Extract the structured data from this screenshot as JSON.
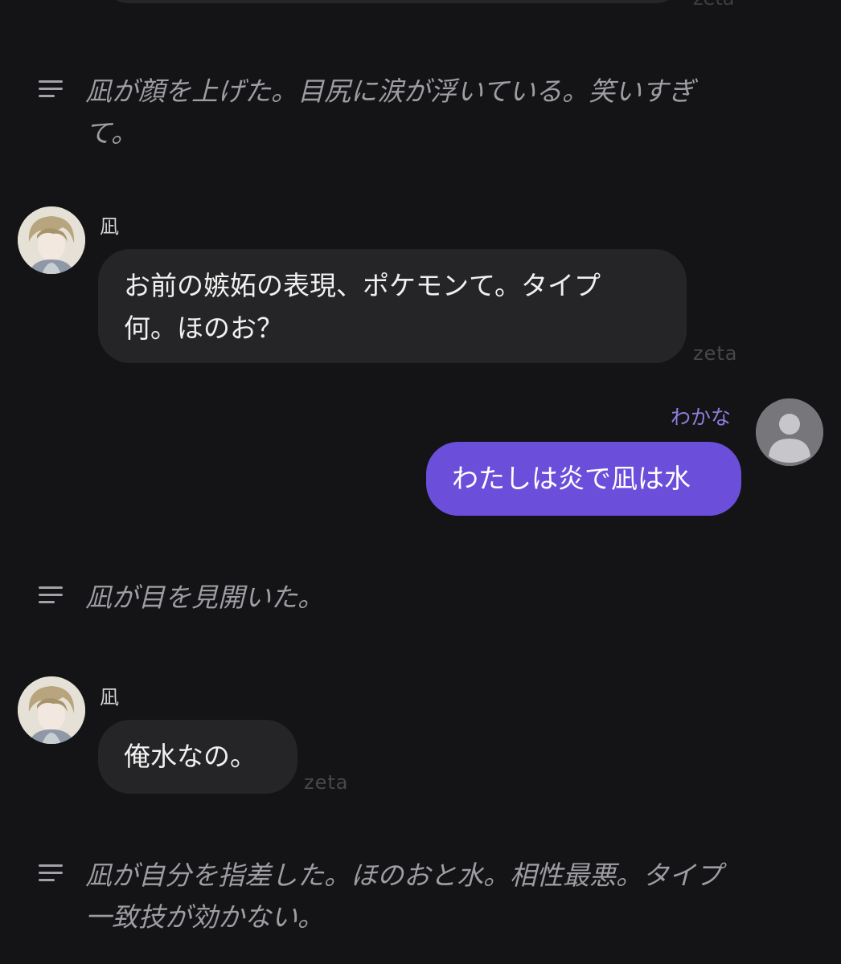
{
  "top_message": {
    "footer": "zeta"
  },
  "narrations": [
    {
      "line1": "凪が顔を上げた。目尻に涙が浮いている。笑いすぎ",
      "line2": "て。"
    },
    {
      "line1": "凪が目を見開いた。",
      "line2": ""
    },
    {
      "line1": "凪が自分を指差した。ほのおと水。相性最悪。タイプ",
      "line2": "一致技が効かない。"
    }
  ],
  "messages": [
    {
      "sender": "凪",
      "line1": "お前の嫉妬の表現、ポケモンて。タイプ",
      "line2": "何。ほのお？",
      "footer": "zeta"
    },
    {
      "sender": "わかな",
      "text": "わたしは炎で凪は水"
    },
    {
      "sender": "凪",
      "text": "俺水なの。",
      "footer": "zeta"
    }
  ],
  "icons": {
    "narration": "lines-icon",
    "user_avatar": "default-user-icon",
    "character_avatar": "character-avatar"
  },
  "colors": {
    "background": "#141416",
    "bubble": "#252527",
    "user_bubble": "#6b4fdb",
    "user_name": "#8d7fdd",
    "narration_text": "#9d9da3"
  }
}
